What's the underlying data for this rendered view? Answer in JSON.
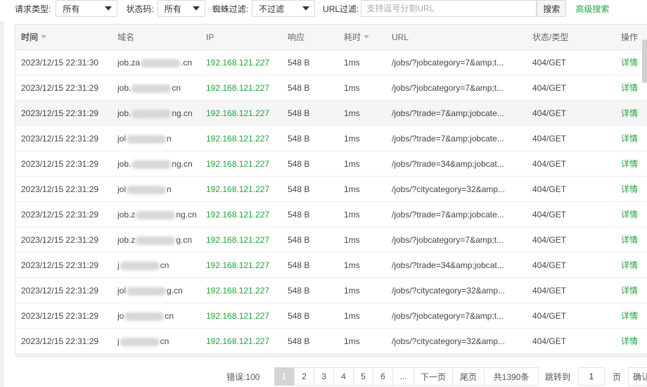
{
  "filters": {
    "request_type_label": "请求类型:",
    "request_type_value": "所有",
    "status_label": "状态码:",
    "status_value": "所有",
    "spider_label": "蜘蛛过滤:",
    "spider_value": "不过滤",
    "url_label": "URL过滤:",
    "url_placeholder": "支持逗号分割URL",
    "url_value": "",
    "search_button": "搜索",
    "advanced_search": "高级搜索"
  },
  "table": {
    "headers": [
      "时间",
      "域名",
      "IP",
      "响应",
      "耗时",
      "URL",
      "状态/类型",
      "操作"
    ],
    "rows": [
      {
        "time": "2023/12/15 22:31:30",
        "domain_start": "job.za",
        "domain_end": ".cn",
        "ip": "192.168.121.227",
        "size": "548 B",
        "duration": "1ms",
        "url": "/jobs/?jobcategory=7&amp;t...",
        "status": "404/GET",
        "action": "详情"
      },
      {
        "time": "2023/12/15 22:31:29",
        "domain_start": "job.",
        "domain_end": "cn",
        "ip": "192.168.121.227",
        "size": "548 B",
        "duration": "1ms",
        "url": "/jobs/?jobcategory=7&amp;t...",
        "status": "404/GET",
        "action": "详情"
      },
      {
        "time": "2023/12/15 22:31:29",
        "domain_start": "job.",
        "domain_end": "ng.cn",
        "ip": "192.168.121.227",
        "size": "548 B",
        "duration": "1ms",
        "url": "/jobs/?trade=7&amp;jobcate...",
        "status": "404/GET",
        "action": "详情"
      },
      {
        "time": "2023/12/15 22:31:29",
        "domain_start": "jol",
        "domain_end": "n",
        "ip": "192.168.121.227",
        "size": "548 B",
        "duration": "1ms",
        "url": "/jobs/?trade=7&amp;jobcate...",
        "status": "404/GET",
        "action": "详情"
      },
      {
        "time": "2023/12/15 22:31:29",
        "domain_start": "job.",
        "domain_end": "ng.cn",
        "ip": "192.168.121.227",
        "size": "548 B",
        "duration": "1ms",
        "url": "/jobs/?trade=34&amp;jobcat...",
        "status": "404/GET",
        "action": "详情"
      },
      {
        "time": "2023/12/15 22:31:29",
        "domain_start": "jol",
        "domain_end": "n",
        "ip": "192.168.121.227",
        "size": "548 B",
        "duration": "1ms",
        "url": "/jobs/?citycategory=32&amp...",
        "status": "404/GET",
        "action": "详情"
      },
      {
        "time": "2023/12/15 22:31:29",
        "domain_start": "job.z",
        "domain_end": "ng.cn",
        "ip": "192.168.121.227",
        "size": "548 B",
        "duration": "1ms",
        "url": "/jobs/?trade=7&amp;jobcate...",
        "status": "404/GET",
        "action": "详情"
      },
      {
        "time": "2023/12/15 22:31:29",
        "domain_start": "job.z",
        "domain_end": "g.cn",
        "ip": "192.168.121.227",
        "size": "548 B",
        "duration": "1ms",
        "url": "/jobs/?jobcategory=7&amp;t...",
        "status": "404/GET",
        "action": "详情"
      },
      {
        "time": "2023/12/15 22:31:29",
        "domain_start": "j",
        "domain_end": "cn",
        "ip": "192.168.121.227",
        "size": "548 B",
        "duration": "1ms",
        "url": "/jobs/?trade=34&amp;jobcat...",
        "status": "404/GET",
        "action": "详情"
      },
      {
        "time": "2023/12/15 22:31:29",
        "domain_start": "jol",
        "domain_end": "g.cn",
        "ip": "192.168.121.227",
        "size": "548 B",
        "duration": "1ms",
        "url": "/jobs/?citycategory=32&amp...",
        "status": "404/GET",
        "action": "详情"
      },
      {
        "time": "2023/12/15 22:31:29",
        "domain_start": "jo",
        "domain_end": "cn",
        "ip": "192.168.121.227",
        "size": "548 B",
        "duration": "1ms",
        "url": "/jobs/?jobcategory=7&amp;t...",
        "status": "404/GET",
        "action": "详情"
      },
      {
        "time": "2023/12/15 22:31:29",
        "domain_start": "j",
        "domain_end": "cn",
        "ip": "192.168.121.227",
        "size": "548 B",
        "duration": "1ms",
        "url": "/jobs/?citycategory=32&amp...",
        "status": "404/GET",
        "action": "详情"
      }
    ]
  },
  "pagination": {
    "errors": "错误:100",
    "pages": [
      "1",
      "2",
      "3",
      "4",
      "5",
      "6",
      "..."
    ],
    "next": "下一页",
    "last": "尾页",
    "total": "共1390条",
    "goto_label": "跳转到",
    "goto_value": "1",
    "page_unit": "页",
    "confirm": "确认"
  }
}
